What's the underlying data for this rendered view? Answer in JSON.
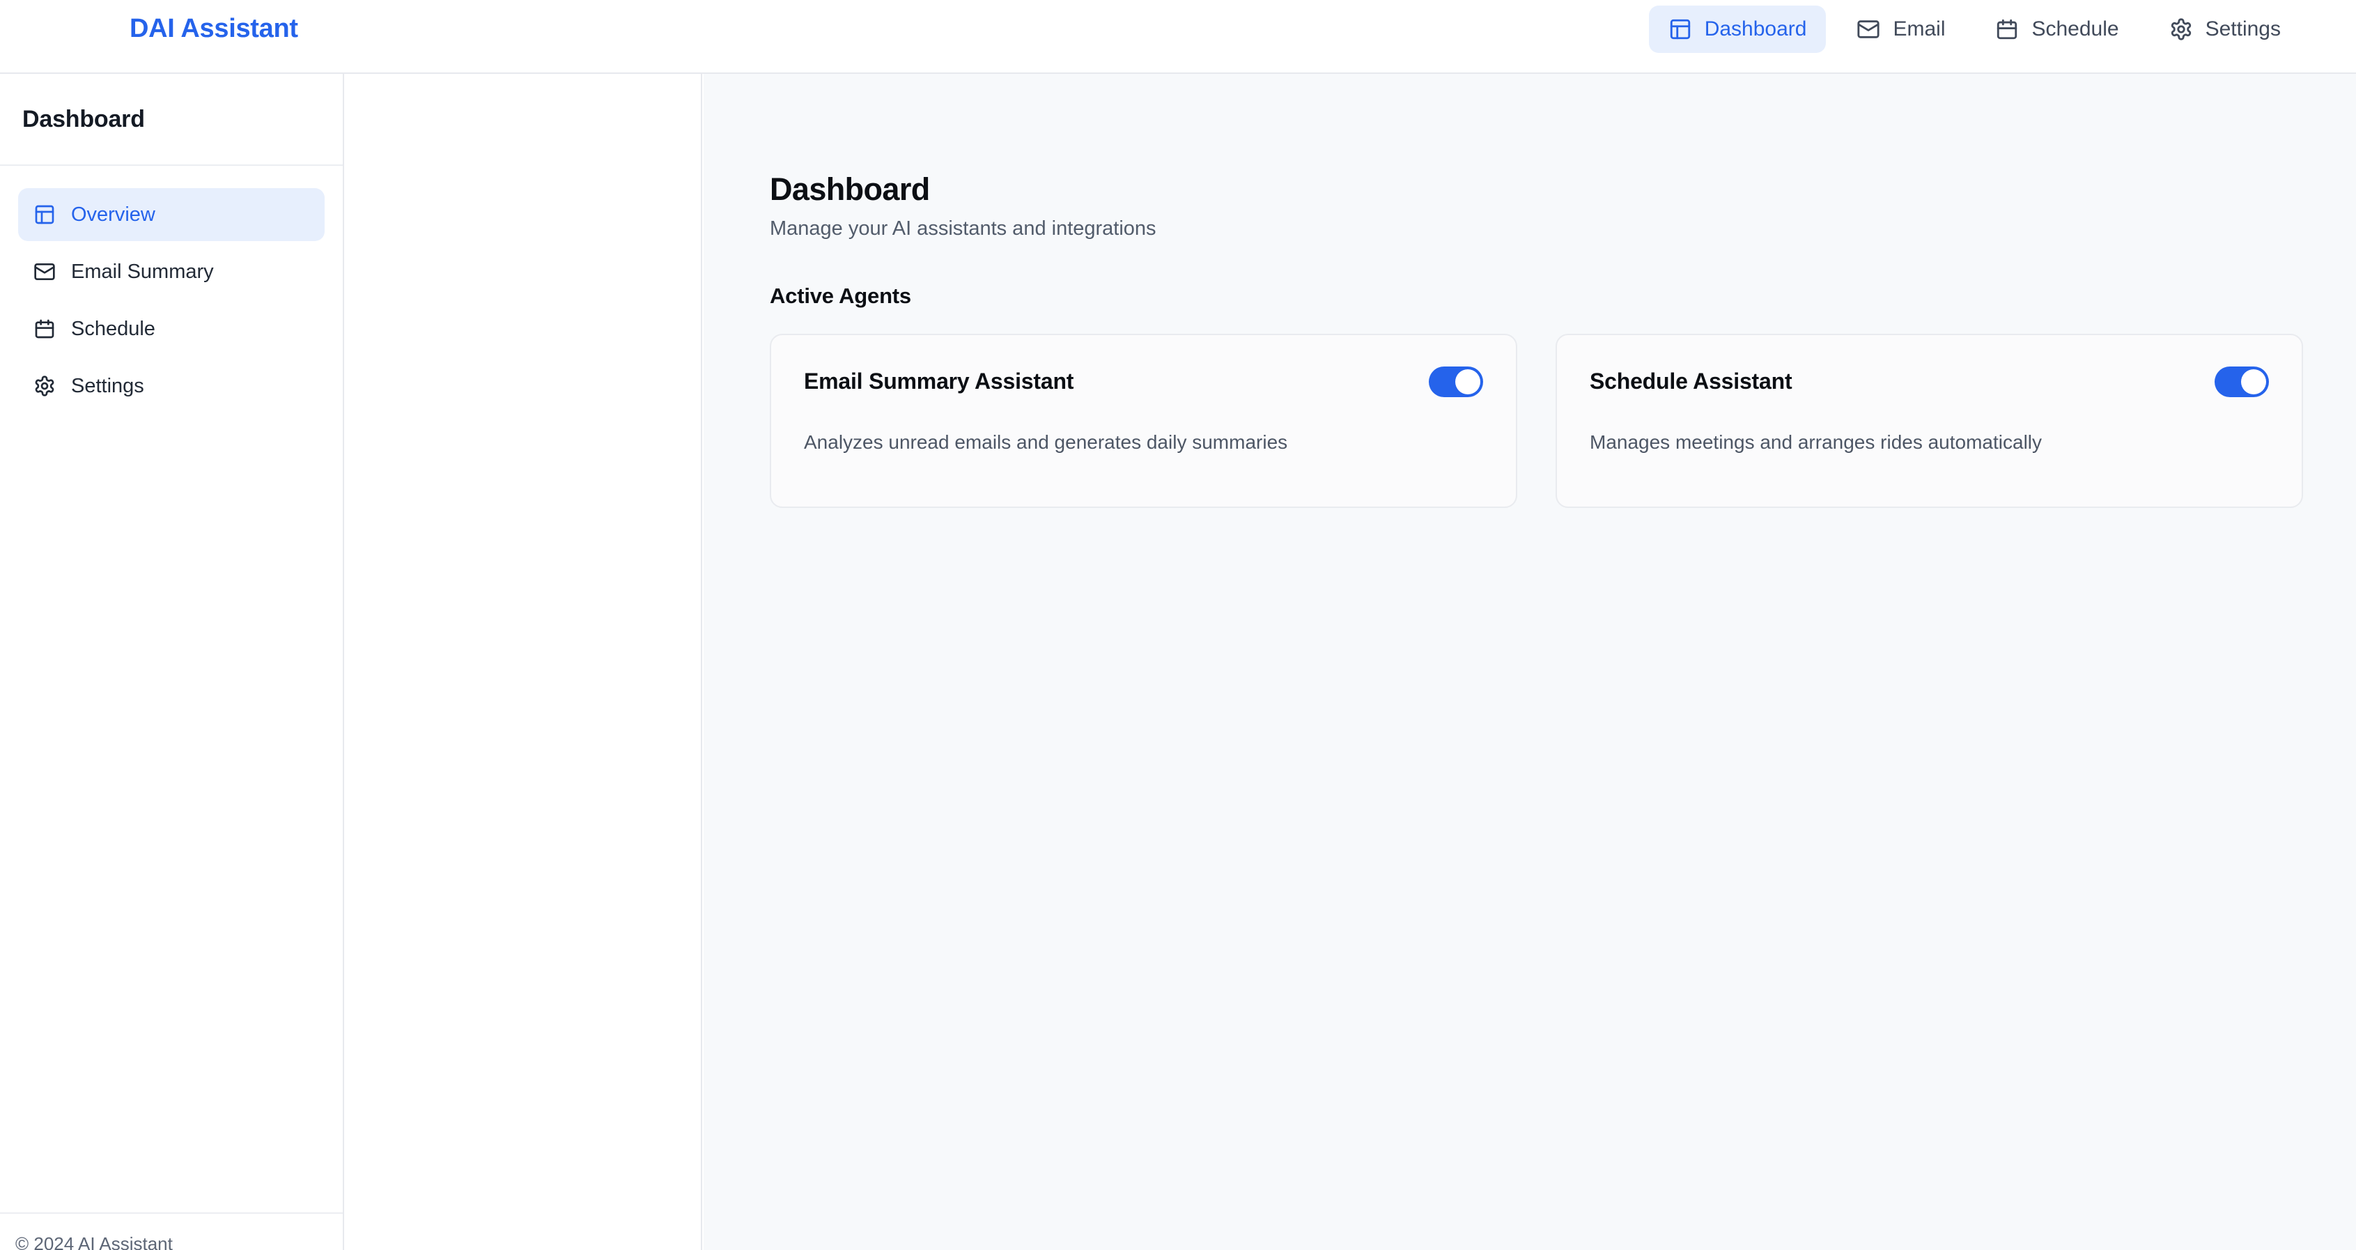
{
  "header": {
    "brand": "DAI Assistant",
    "nav": [
      {
        "label": "Dashboard",
        "icon": "layout-dashboard-icon",
        "active": true
      },
      {
        "label": "Email",
        "icon": "envelope-icon",
        "active": false
      },
      {
        "label": "Schedule",
        "icon": "calendar-icon",
        "active": false
      },
      {
        "label": "Settings",
        "icon": "gear-icon",
        "active": false
      }
    ]
  },
  "sidebar": {
    "title": "Dashboard",
    "items": [
      {
        "label": "Overview",
        "icon": "layout-dashboard-icon",
        "active": true
      },
      {
        "label": "Email Summary",
        "icon": "envelope-icon",
        "active": false
      },
      {
        "label": "Schedule",
        "icon": "calendar-icon",
        "active": false
      },
      {
        "label": "Settings",
        "icon": "gear-icon",
        "active": false
      }
    ],
    "footer": "© 2024 AI Assistant"
  },
  "main": {
    "title": "Dashboard",
    "subtitle": "Manage your AI assistants and integrations",
    "section_title": "Active Agents",
    "agents": [
      {
        "title": "Email Summary Assistant",
        "description": "Analyzes unread emails and generates daily summaries",
        "enabled": true
      },
      {
        "title": "Schedule Assistant",
        "description": "Manages meetings and arranges rides automatically",
        "enabled": true
      }
    ]
  },
  "colors": {
    "accent": "#2563eb",
    "accent_soft": "#e7effd",
    "text": "#0c0f14",
    "muted": "#525c6b",
    "border": "#e7e9ee",
    "main_bg": "#f7f9fb",
    "card_bg": "#fbfbfc"
  }
}
